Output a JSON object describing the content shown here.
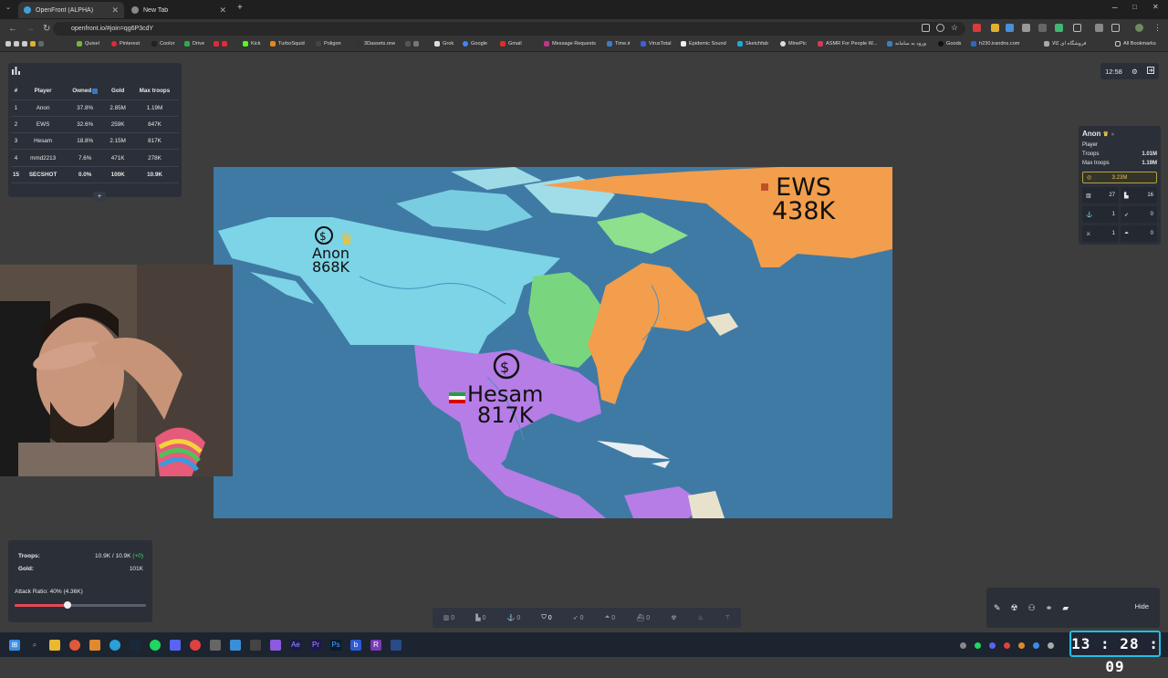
{
  "browser": {
    "tabs": [
      {
        "title": "OpenFront (ALPHA)",
        "active": true
      },
      {
        "title": "New Tab",
        "active": false
      }
    ],
    "new_tab_icon": "+",
    "window_controls": {
      "minimize": "–",
      "maximize": "□",
      "close": "✕"
    },
    "url": "openfront.io/#join=qg6P3cdY",
    "bookmarks": [
      "Quixel",
      "Pinterest",
      "Coolor",
      "Drive",
      "Kick",
      "TurboSquid",
      "Poligon",
      "3Dassets.one",
      "Grok",
      "Google",
      "Gmail",
      "Message Requests",
      "Time.ir",
      "VirusTotal",
      "Epidemic Sound",
      "Sketchfab",
      "MinePic",
      "ASMR For People W...",
      "ورود به سامانه",
      "Goods",
      "h230.irandns.com",
      "فروشگاه ای کالا"
    ],
    "all_bookmarks": "All Bookmarks"
  },
  "leaderboard": {
    "columns": [
      "#",
      "Player",
      "Owned",
      "Gold",
      "Max troops"
    ],
    "rows": [
      {
        "rank": "1",
        "player": "Anon",
        "owned": "37.8%",
        "gold": "2.85M",
        "max_troops": "1.19M"
      },
      {
        "rank": "2",
        "player": "EWS",
        "owned": "32.6%",
        "gold": "259K",
        "max_troops": "847K"
      },
      {
        "rank": "3",
        "player": "Hesam",
        "owned": "18.8%",
        "gold": "2.15M",
        "max_troops": "817K"
      },
      {
        "rank": "4",
        "player": "mmd2213",
        "owned": "7.6%",
        "gold": "471K",
        "max_troops": "278K"
      },
      {
        "rank": "15",
        "player": "SECSHOT",
        "owned": "0.0%",
        "gold": "100K",
        "max_troops": "10.9K"
      }
    ],
    "expand_label": "+"
  },
  "clock": {
    "time": "12:58"
  },
  "player_panel": {
    "name": "Anon",
    "type": "Player",
    "troops_label": "Troops",
    "troops_value": "1.01M",
    "max_troops_label": "Max troops",
    "max_troops_value": "1.19M",
    "gold": "3.23M",
    "cells": [
      {
        "icon": "city-icon",
        "value": "27"
      },
      {
        "icon": "factory-icon",
        "value": "16"
      },
      {
        "icon": "port-icon",
        "value": "1"
      },
      {
        "icon": "missile-silo-icon",
        "value": "0"
      },
      {
        "icon": "defense-post-icon",
        "value": "1"
      },
      {
        "icon": "sam-launcher-icon",
        "value": "0"
      }
    ]
  },
  "map": {
    "labels": [
      {
        "name": "Anon",
        "troops": "868K"
      },
      {
        "name": "EWS",
        "troops": "438K"
      },
      {
        "name": "Hesam",
        "troops": "817K"
      }
    ]
  },
  "stats": {
    "troops_label": "Troops:",
    "troops_value": "10.9K / 10.9K",
    "troops_delta": "(+0)",
    "gold_label": "Gold:",
    "gold_value": "101K",
    "attack_ratio_label": "Attack Ratio: 40% (4.36K)",
    "attack_ratio": 0.4
  },
  "action_bar": [
    {
      "icon": "city-icon",
      "count": "0"
    },
    {
      "icon": "factory-icon",
      "count": "0"
    },
    {
      "icon": "port-icon",
      "count": "0"
    },
    {
      "icon": "defense-post-icon",
      "count": "0"
    },
    {
      "icon": "missile-silo-icon",
      "count": "0"
    },
    {
      "icon": "sam-launcher-icon",
      "count": "0"
    },
    {
      "icon": "warship-icon",
      "count": "0"
    }
  ],
  "tool_panel": {
    "hide_label": "Hide"
  },
  "taskbar": {
    "time": "13 : 28 : 09"
  }
}
